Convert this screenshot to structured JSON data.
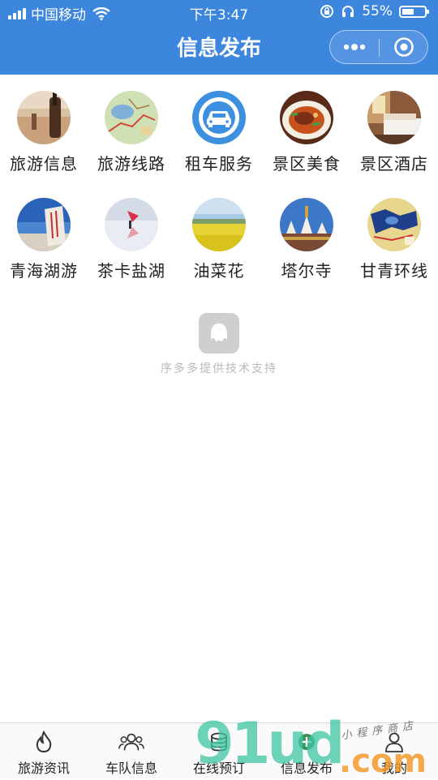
{
  "status_bar": {
    "carrier": "中国移动",
    "time": "下午3:47",
    "battery_percent": "55%",
    "battery_level": 0.55
  },
  "nav": {
    "title": "信息发布"
  },
  "grid": [
    {
      "label": "旅游信息",
      "icon": "photo-desert-guitar"
    },
    {
      "label": "旅游线路",
      "icon": "photo-route-map"
    },
    {
      "label": "租车服务",
      "icon": "car-icon",
      "color": "#3d8fe0"
    },
    {
      "label": "景区美食",
      "icon": "photo-noodle-dish"
    },
    {
      "label": "景区酒店",
      "icon": "photo-hotel-room"
    },
    {
      "label": "青海湖游",
      "icon": "photo-qinghai-lake-stone"
    },
    {
      "label": "茶卡盐湖",
      "icon": "photo-salt-lake"
    },
    {
      "label": "油菜花",
      "icon": "photo-rapeseed-field"
    },
    {
      "label": "塔尔寺",
      "icon": "photo-kumbum-temple"
    },
    {
      "label": "甘青环线",
      "icon": "photo-loop-map"
    }
  ],
  "powered_by": {
    "text": "序多多提供技术支持",
    "icon": "octopus-logo-icon"
  },
  "tabs": [
    {
      "label": "旅游资讯",
      "icon": "flame-icon"
    },
    {
      "label": "车队信息",
      "icon": "team-icon"
    },
    {
      "label": "在线预订",
      "icon": "coins-icon"
    },
    {
      "label": "信息发布",
      "icon": "plus-icon"
    },
    {
      "label": "我的",
      "icon": "user-icon"
    }
  ],
  "watermark": {
    "brand_a": "91ud",
    "brand_b": ".com",
    "sub": "小程序商店"
  },
  "colors": {
    "primary": "#3d86de",
    "watermark_green": "#3ec6a2",
    "watermark_orange": "#f39a2c"
  }
}
